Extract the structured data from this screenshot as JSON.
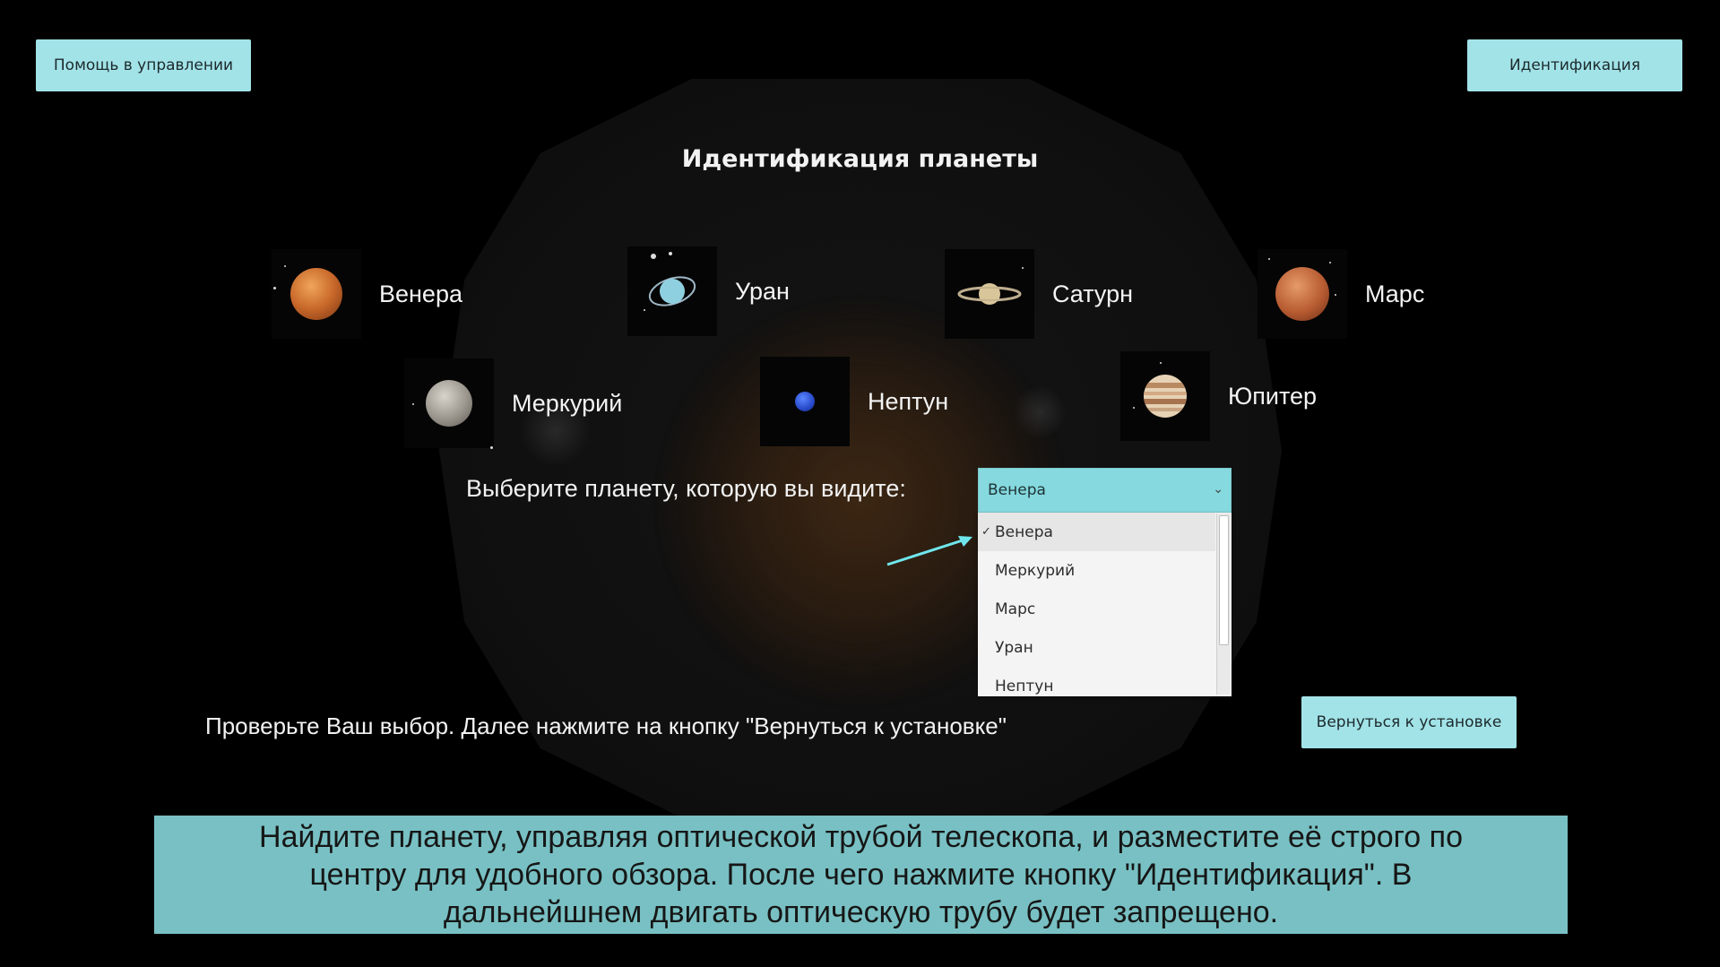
{
  "header": {
    "help_button": "Помощь в управлении",
    "identify_button": "Идентификация"
  },
  "title": "Идентификация планеты",
  "planets": {
    "venus": "Венера",
    "uranus": "Уран",
    "saturn": "Сатурн",
    "mars": "Марс",
    "mercury": "Меркурий",
    "neptune": "Нептун",
    "jupiter": "Юпитер"
  },
  "selection": {
    "prompt": "Выберите планету, которую вы видите:",
    "selected_value": "Венера",
    "options": [
      "Венера",
      "Меркурий",
      "Марс",
      "Уран",
      "Нептун"
    ]
  },
  "check_text": "Проверьте Ваш выбор. Далее нажмите на кнопку \"Вернуться к установке\"",
  "back_button": "Вернуться к установке",
  "instruction": "Найдите планету, управляя оптической трубой телескопа, и разместите её строго по центру для удобного обзора. После чего нажмите кнопку \"Идентификация\". В дальнейшнем двигать оптическую трубу будет запрещено.",
  "colors": {
    "button_bg": "#a2e3e8",
    "dropdown_bg": "#85d9df",
    "instruction_bg": "#78c0c3",
    "arrow": "#6fe6ec"
  }
}
